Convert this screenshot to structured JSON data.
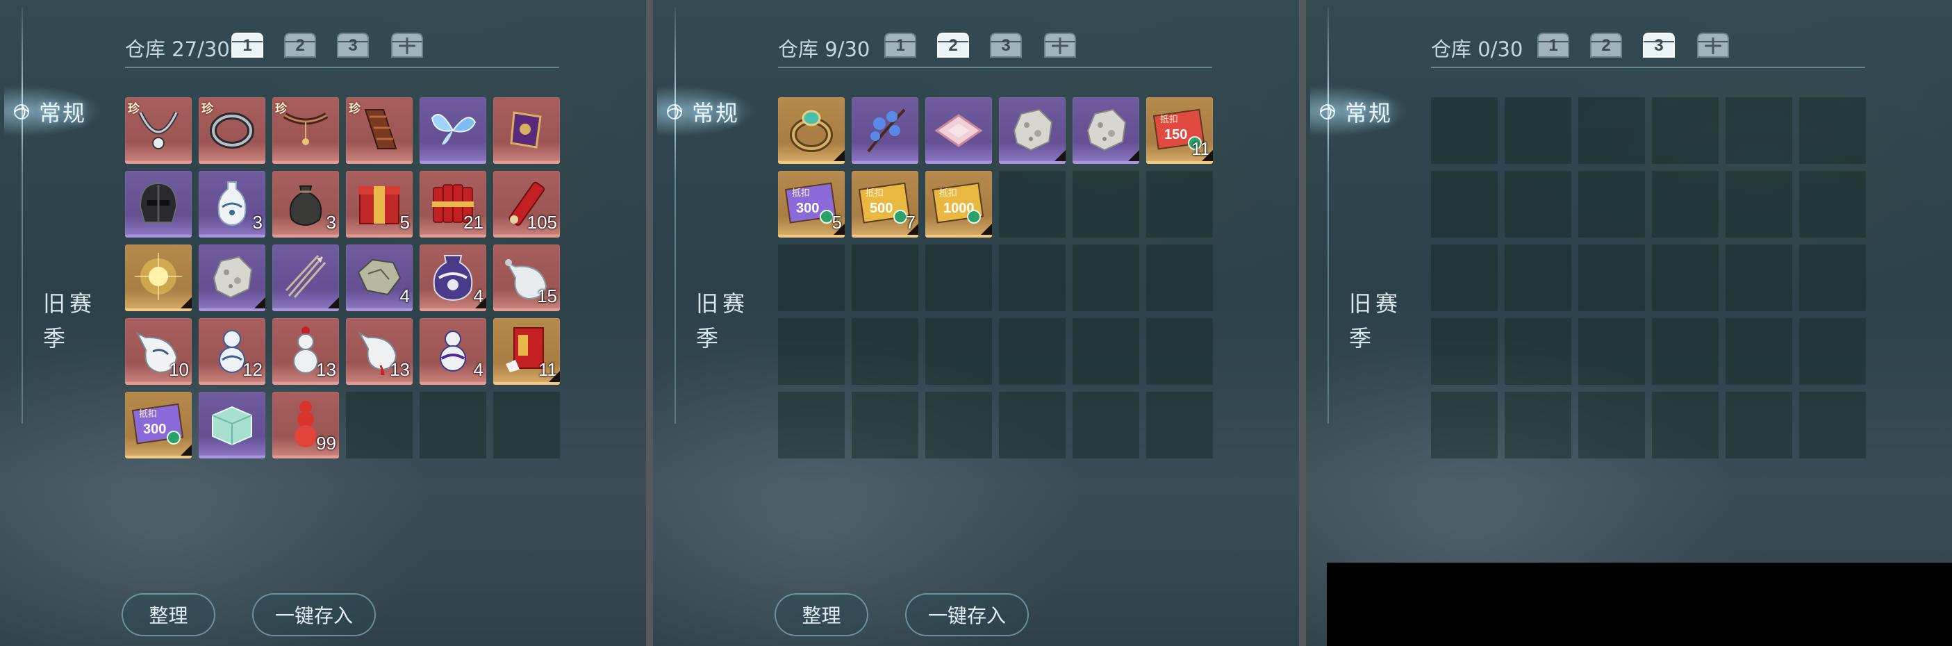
{
  "panels": [
    {
      "id": "p1",
      "warehouse_label": "仓库",
      "count": "27/30",
      "tab_active": "常规",
      "tab_old": "旧赛季",
      "selected_chest": 0,
      "chest_labels": [
        "1",
        "2",
        "3",
        ""
      ],
      "sort_label": "整理",
      "deposit_label": "一键存入",
      "items": [
        {
          "name": "silver-necklace",
          "quality": "red",
          "rare": "珍",
          "count": ""
        },
        {
          "name": "silver-ring",
          "quality": "red",
          "rare": "珍",
          "count": ""
        },
        {
          "name": "pendant-collar",
          "quality": "red",
          "rare": "珍",
          "count": ""
        },
        {
          "name": "leather-bracer",
          "quality": "red",
          "rare": "珍",
          "count": ""
        },
        {
          "name": "blue-butterfly",
          "quality": "purple",
          "rare": "",
          "count": ""
        },
        {
          "name": "purple-charm",
          "quality": "red",
          "rare": "",
          "count": ""
        },
        {
          "name": "iron-helmet",
          "quality": "purple",
          "rare": "",
          "count": ""
        },
        {
          "name": "porcelain-vase",
          "quality": "purple",
          "rare": "",
          "count": "3"
        },
        {
          "name": "pouch-bag",
          "quality": "red",
          "rare": "",
          "count": "3"
        },
        {
          "name": "red-gift-box",
          "quality": "red",
          "rare": "",
          "count": "5"
        },
        {
          "name": "firecracker-bundle",
          "quality": "red",
          "rare": "",
          "count": "21"
        },
        {
          "name": "firecracker-single",
          "quality": "red",
          "rare": "",
          "count": "105"
        },
        {
          "name": "golden-light-orb",
          "quality": "gold",
          "rare": "",
          "count": ""
        },
        {
          "name": "white-stone",
          "quality": "purple",
          "rare": "",
          "count": ""
        },
        {
          "name": "arrows",
          "quality": "purple",
          "rare": "",
          "count": ""
        },
        {
          "name": "map-fragment",
          "quality": "purple",
          "rare": "",
          "count": "4"
        },
        {
          "name": "large-jar",
          "quality": "red",
          "rare": "",
          "count": "4"
        },
        {
          "name": "white-flask",
          "quality": "red",
          "rare": "",
          "count": "15"
        },
        {
          "name": "porcelain-bottle",
          "quality": "red",
          "rare": "",
          "count": "10"
        },
        {
          "name": "blue-gourd",
          "quality": "red",
          "rare": "",
          "count": "12"
        },
        {
          "name": "red-cap-gourd",
          "quality": "red",
          "rare": "",
          "count": "13"
        },
        {
          "name": "tassel-bottle",
          "quality": "red",
          "rare": "",
          "count": "13"
        },
        {
          "name": "purple-gourd",
          "quality": "red",
          "rare": "",
          "count": "4"
        },
        {
          "name": "red-envelope",
          "quality": "gold",
          "rare": "",
          "count": "11"
        },
        {
          "name": "coupon-300",
          "quality": "gold",
          "rare": "",
          "count": "",
          "coupon_word": "抵扣",
          "coupon_value": "300"
        },
        {
          "name": "jade-box",
          "quality": "purple",
          "rare": "",
          "count": ""
        },
        {
          "name": "red-gourd",
          "quality": "red",
          "rare": "",
          "count": "99"
        }
      ]
    },
    {
      "id": "p2",
      "warehouse_label": "仓库",
      "count": "9/30",
      "tab_active": "常规",
      "tab_old": "旧赛季",
      "selected_chest": 1,
      "chest_labels": [
        "1",
        "2",
        "3",
        ""
      ],
      "sort_label": "整理",
      "deposit_label": "一键存入",
      "items": [
        {
          "name": "jade-bracelet",
          "quality": "gold",
          "rare": "",
          "count": ""
        },
        {
          "name": "blue-flower-branch",
          "quality": "purple",
          "rare": "",
          "count": ""
        },
        {
          "name": "silk-cushion",
          "quality": "purple",
          "rare": "",
          "count": ""
        },
        {
          "name": "white-stone",
          "quality": "purple",
          "rare": "",
          "count": ""
        },
        {
          "name": "white-stone",
          "quality": "purple",
          "rare": "",
          "count": ""
        },
        {
          "name": "coupon-150",
          "quality": "gold",
          "rare": "",
          "count": "11",
          "coupon_word": "抵扣",
          "coupon_value": "150"
        },
        {
          "name": "coupon-300",
          "quality": "gold",
          "rare": "",
          "count": "5",
          "coupon_word": "抵扣",
          "coupon_value": "300"
        },
        {
          "name": "coupon-500",
          "quality": "gold",
          "rare": "",
          "count": "7",
          "coupon_word": "抵扣",
          "coupon_value": "500"
        },
        {
          "name": "coupon-1000",
          "quality": "gold",
          "rare": "",
          "count": "",
          "coupon_word": "抵扣",
          "coupon_value": "1000"
        }
      ]
    },
    {
      "id": "p3",
      "warehouse_label": "仓库",
      "count": "0/30",
      "tab_active": "常规",
      "tab_old": "旧赛季",
      "selected_chest": 2,
      "chest_labels": [
        "1",
        "2",
        "3",
        ""
      ],
      "sort_label": "",
      "deposit_label": "",
      "items": []
    }
  ],
  "colors": {
    "quality_red": "#a85e5c",
    "quality_purple": "#6f5c9e",
    "quality_gold": "#b68a4c",
    "accent_glow": "#bfe6ff"
  }
}
